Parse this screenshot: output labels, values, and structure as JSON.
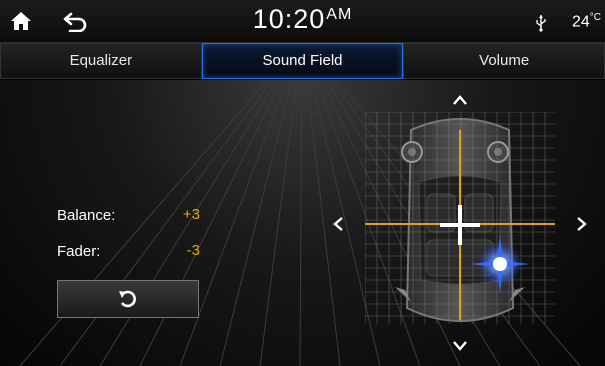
{
  "status": {
    "time": "10:20",
    "ampm": "AM",
    "temperature": "24",
    "temperature_unit": "°C"
  },
  "tabs": [
    {
      "label": "Equalizer",
      "active": false
    },
    {
      "label": "Sound Field",
      "active": true
    },
    {
      "label": "Volume",
      "active": false
    }
  ],
  "settings": {
    "balance_label": "Balance:",
    "balance_value": "+3",
    "fader_label": "Fader:",
    "fader_value": "-3"
  },
  "icons": {
    "home": "home-icon",
    "back": "back-arrow-icon",
    "usb": "usb-icon",
    "reset": "reset-icon",
    "up": "chevron-up-icon",
    "down": "chevron-down-icon",
    "left": "chevron-left-icon",
    "right": "chevron-right-icon"
  },
  "colors": {
    "accent_blue": "#2f6de0",
    "value_orange": "#f0a400",
    "crosshair_orange": "#e0a020"
  }
}
